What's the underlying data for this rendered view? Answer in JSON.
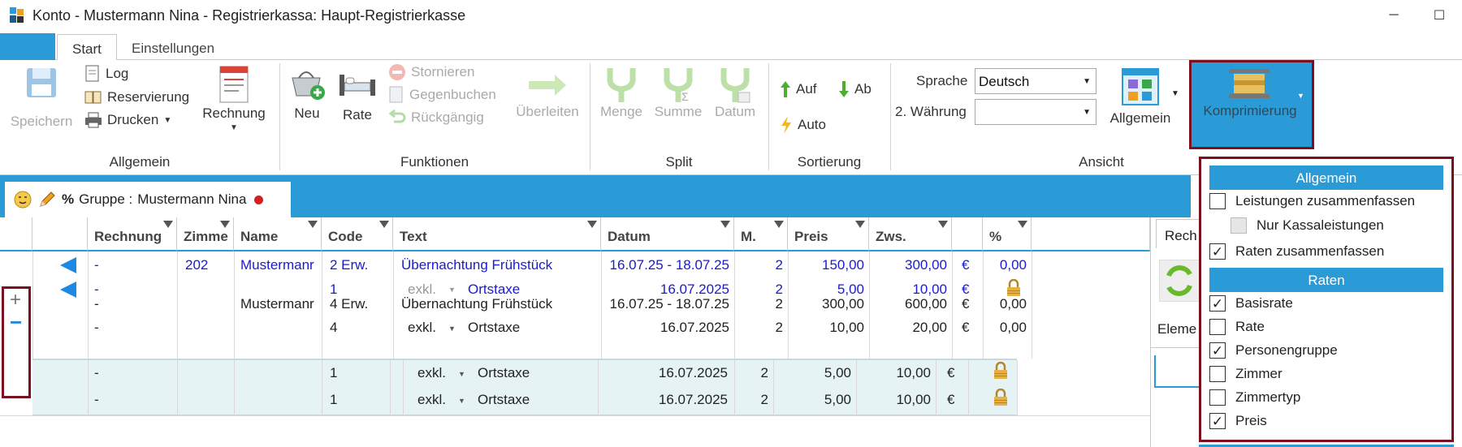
{
  "window": {
    "title": "Konto - Mustermann Nina - Registrierkassa: Haupt-Registrierkasse",
    "minimize": "─",
    "maximize": "☐"
  },
  "tabs": {
    "start": "Start",
    "settings": "Einstellungen"
  },
  "ribbon": {
    "allgemein": {
      "save": "Speichern",
      "log": "Log",
      "reservation": "Reservierung",
      "print": "Drucken",
      "invoice": "Rechnung",
      "group_label": "Allgemein"
    },
    "funktionen": {
      "new": "Neu",
      "rate": "Rate",
      "cancel": "Stornieren",
      "counter_book": "Gegenbuchen",
      "undo": "Rückgängig",
      "transfer": "Überleiten",
      "group_label": "Funktionen"
    },
    "split": {
      "quantity": "Menge",
      "sum": "Summe",
      "date": "Datum",
      "group_label": "Split"
    },
    "sortierung": {
      "up": "Auf",
      "down": "Ab",
      "auto": "Auto",
      "group_label": "Sortierung"
    },
    "ansicht": {
      "language_label": "Sprache",
      "language_value": "Deutsch",
      "currency_label": "2. Währung",
      "currency_value": "",
      "general": "Allgemein",
      "compress": "Komprimierung",
      "group_label": "Ansicht"
    }
  },
  "group_tab": {
    "prefix": "%",
    "label": "Gruppe :",
    "name": "Mustermann Nina"
  },
  "columns": [
    "Rechnung",
    "Zimme",
    "Name",
    "Code",
    "Text",
    "Datum",
    "M.",
    "Preis",
    "Zws.",
    "%"
  ],
  "rows": [
    {
      "rechnung": "-",
      "zimmer": "202",
      "name": "Mustermanr",
      "code": "2 Erw.",
      "text": "Übernachtung Frühstück",
      "datum": "16.07.25 - 18.07.25",
      "m": "2",
      "preis": "150,00",
      "zws": "300,00",
      "cur": "€",
      "pct": "0,00"
    },
    {
      "rechnung": "-",
      "zimmer": "",
      "name": "",
      "code": "1",
      "excl": "exkl.",
      "text": "Ortstaxe",
      "datum": "16.07.2025",
      "m": "2",
      "preis": "5,00",
      "zws": "10,00",
      "cur": "€",
      "pct": ""
    },
    {
      "rechnung": "-",
      "zimmer": "",
      "name": "Mustermanr",
      "code": "4 Erw.",
      "text": "Übernachtung Frühstück",
      "datum": "16.07.25 - 18.07.25",
      "m": "2",
      "preis": "300,00",
      "zws": "600,00",
      "cur": "€",
      "pct": "0,00"
    },
    {
      "rechnung": "-",
      "zimmer": "",
      "name": "",
      "code": "4",
      "excl": "exkl.",
      "text": "Ortstaxe",
      "datum": "16.07.2025",
      "m": "2",
      "preis": "10,00",
      "zws": "20,00",
      "cur": "€",
      "pct": "0,00"
    }
  ],
  "subrows": [
    {
      "rechnung": "-",
      "code": "1",
      "excl": "exkl.",
      "text": "Ortstaxe",
      "datum": "16.07.2025",
      "m": "2",
      "preis": "5,00",
      "zws": "10,00",
      "cur": "€"
    },
    {
      "rechnung": "-",
      "code": "1",
      "excl": "exkl.",
      "text": "Ortstaxe",
      "datum": "16.07.2025",
      "m": "2",
      "preis": "5,00",
      "zws": "10,00",
      "cur": "€"
    }
  ],
  "side_panel": {
    "tab": "Rech",
    "label": "Eleme"
  },
  "expanders": {
    "plus": "+",
    "minus": "−"
  },
  "dropdown": {
    "section1": "Allgemein",
    "items1": [
      {
        "label": "Leistungen zusammenfassen",
        "checked": false
      },
      {
        "label": "Nur Kassaleistungen",
        "checked": false,
        "disabled": true
      },
      {
        "label": "Raten zusammenfassen",
        "checked": true
      }
    ],
    "section2": "Raten",
    "items2": [
      {
        "label": "Basisrate",
        "checked": true
      },
      {
        "label": "Rate",
        "checked": false
      },
      {
        "label": "Personengruppe",
        "checked": true
      },
      {
        "label": "Zimmer",
        "checked": false
      },
      {
        "label": "Zimmertyp",
        "checked": false
      },
      {
        "label": "Preis",
        "checked": true
      }
    ]
  },
  "colors": {
    "accent": "#2b9bd8",
    "highlight_border": "#7a1020",
    "link_blue": "#1a1ad0",
    "subrow_bg": "#e6f3f5"
  }
}
